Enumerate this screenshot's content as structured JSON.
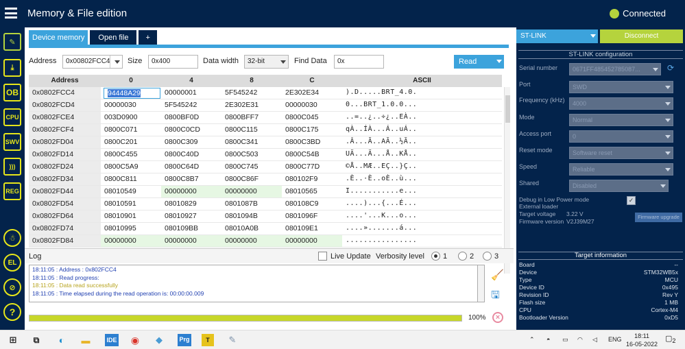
{
  "app": {
    "title": "Memory & File edition",
    "status": "Connected"
  },
  "sidebar": {
    "items": [
      {
        "name": "memory-edit",
        "glyph": "✎"
      },
      {
        "name": "erase-program",
        "glyph": "⤓"
      },
      {
        "name": "option-bytes",
        "glyph": "OB"
      },
      {
        "name": "cpu",
        "glyph": "CPU"
      },
      {
        "name": "swv",
        "glyph": "SWV"
      },
      {
        "name": "live-data",
        "glyph": ")))"
      },
      {
        "name": "register",
        "glyph": "REG"
      },
      {
        "name": "beta-tool",
        "glyph": "☃"
      },
      {
        "name": "el-tool",
        "glyph": "EL"
      },
      {
        "name": "security",
        "glyph": "⊘"
      },
      {
        "name": "help",
        "glyph": "?"
      }
    ]
  },
  "tabs": [
    {
      "label": "Device memory"
    },
    {
      "label": "Open file"
    },
    {
      "label": "+"
    }
  ],
  "controls": {
    "address_label": "Address",
    "address_value": "0x00802FCC4",
    "size_label": "Size",
    "size_value": "0x400",
    "width_label": "Data width",
    "width_value": "32-bit",
    "find_label": "Find Data",
    "find_value": "0x",
    "read_label": "Read"
  },
  "table": {
    "headers": [
      "Address",
      "0",
      "4",
      "8",
      "C",
      "ASCII"
    ],
    "rows": [
      {
        "addr": "0x0802FCC4",
        "c0": "94448A29",
        "c4": "00000001",
        "c8": "5F545242",
        "cc": "2E302E34",
        "ascii": ").D.....BRT_4.0."
      },
      {
        "addr": "0x0802FCD4",
        "c0": "00000030",
        "c4": "5F545242",
        "c8": "2E302E31",
        "cc": "00000030",
        "ascii": "0...BRT_1.0.0..."
      },
      {
        "addr": "0x0802FCE4",
        "c0": "003D0900",
        "c4": "0800BF0D",
        "c8": "0800BFF7",
        "cc": "0800C045",
        "ascii": "..=..¿..÷¿..EÀ.."
      },
      {
        "addr": "0x0802FCF4",
        "c0": "0800C071",
        "c4": "0800C0CD",
        "c8": "0800C115",
        "cc": "0800C175",
        "ascii": "qÀ..ÍÀ...Á..uÁ.."
      },
      {
        "addr": "0x0802FD04",
        "c0": "0800C201",
        "c4": "0800C309",
        "c8": "0800C341",
        "cc": "0800C3BD",
        "ascii": ".Â...Ã..AÃ..½Ã.."
      },
      {
        "addr": "0x0802FD14",
        "c0": "0800C455",
        "c4": "0800C40D",
        "c8": "0800C503",
        "cc": "0800C54B",
        "ascii": "UÄ...Ä...Å..KÅ.."
      },
      {
        "addr": "0x0802FD24",
        "c0": "0800C5A9",
        "c4": "0800C64D",
        "c8": "0800C745",
        "cc": "0800C77D",
        "ascii": "©Å..MÆ..EÇ..}Ç.."
      },
      {
        "addr": "0x0802FD34",
        "c0": "0800C811",
        "c4": "0800C8B7",
        "c8": "0800C86F",
        "cc": "080102F9",
        "ascii": ".È..·È..oÈ..ù..."
      },
      {
        "addr": "0x0802FD44",
        "c0": "08010549",
        "c4": "00000000",
        "c8": "00000000",
        "cc": "08010565",
        "ascii": "I...........e..."
      },
      {
        "addr": "0x0802FD54",
        "c0": "08010591",
        "c4": "08010829",
        "c8": "0801087B",
        "cc": "080108C9",
        "ascii": "....)...{...É..."
      },
      {
        "addr": "0x0802FD64",
        "c0": "08010901",
        "c4": "08010927",
        "c8": "0801094B",
        "cc": "0801096F",
        "ascii": "....'...K...o..."
      },
      {
        "addr": "0x0802FD74",
        "c0": "08010995",
        "c4": "080109BB",
        "c8": "08010A0B",
        "cc": "080109E1",
        "ascii": "....».......á..."
      },
      {
        "addr": "0x0802FD84",
        "c0": "00000000",
        "c4": "00000000",
        "c8": "00000000",
        "cc": "00000000",
        "ascii": "................"
      }
    ]
  },
  "log": {
    "title": "Log",
    "live_update": "Live Update",
    "verbosity_label": "Verbosity level",
    "levels": [
      "1",
      "2",
      "3"
    ],
    "lines": [
      {
        "text": "18:11:05 :   Address      : 0x802FCC4",
        "kind": "t"
      },
      {
        "text": "18:11:05 : Read progress:",
        "kind": "t"
      },
      {
        "text": "18:11:05 : Data read successfully",
        "kind": "y"
      },
      {
        "text": "18:11:05 : Time elapsed during the read operation is: 00:00:00.009",
        "kind": "t"
      }
    ],
    "progress": 1.0,
    "progress_label": "100%"
  },
  "stlink": {
    "probe": "ST-LINK",
    "disconnect": "Disconnect",
    "config_title": "ST-LINK configuration",
    "serial_label": "Serial number",
    "serial_value": "0671FF485452785087...",
    "port_label": "Port",
    "port_value": "SWD",
    "freq_label": "Frequency (kHz)",
    "freq_value": "4000",
    "mode_label": "Mode",
    "mode_value": "Normal",
    "ap_label": "Access port",
    "ap_value": "0",
    "reset_label": "Reset mode",
    "reset_value": "Software reset",
    "speed_label": "Speed",
    "speed_value": "Reliable",
    "shared_label": "Shared",
    "shared_value": "Disabled",
    "lowpower": "Debug in Low Power mode",
    "ext_loader": "External loader",
    "voltage_label": "Target voltage",
    "voltage_value": "3.22 V",
    "fw_label": "Firmware version",
    "fw_value": "V2J39M27",
    "fw_upgrade": "Firmware upgrade"
  },
  "target": {
    "title": "Target information",
    "rows": [
      {
        "k": "Board",
        "v": "--"
      },
      {
        "k": "Device",
        "v": "STM32WB5x"
      },
      {
        "k": "Type",
        "v": "MCU"
      },
      {
        "k": "Device ID",
        "v": "0x495"
      },
      {
        "k": "Revision ID",
        "v": "Rev Y"
      },
      {
        "k": "Flash size",
        "v": "1 MB"
      },
      {
        "k": "CPU",
        "v": "Cortex-M4"
      },
      {
        "k": "Bootloader Version",
        "v": "0xD5"
      }
    ]
  },
  "taskbar": {
    "icons": [
      "windows-start",
      "task-view",
      "edge",
      "file-explorer",
      "ide",
      "chrome",
      "app",
      "programmer",
      "t-app",
      "paint"
    ],
    "labels": {
      "ide": "IDE",
      "programmer": "Prg",
      "t-app": "T"
    },
    "lang": "ENG",
    "time": "18:11",
    "date": "16-05-2022",
    "notifications": "2"
  },
  "colors": {
    "navy": "#03234b",
    "accent": "#3ca3dc",
    "connected": "#b5d33d",
    "progress": "#c7d72a"
  }
}
